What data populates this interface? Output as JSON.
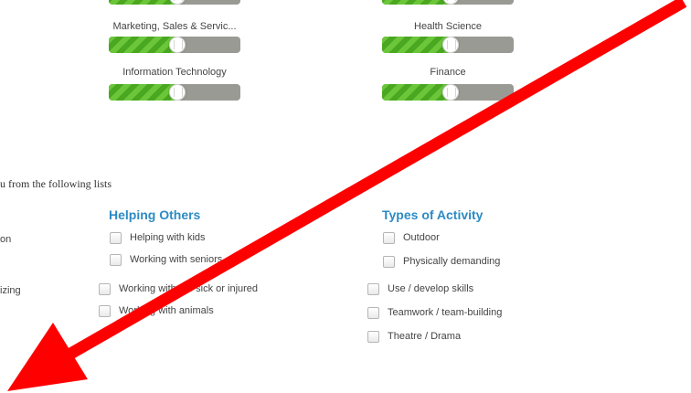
{
  "sliders": [
    {
      "label": "Marketing, Sales & Servic...",
      "level_percent": 52
    },
    {
      "label": "Health Science",
      "level_percent": 52
    },
    {
      "label": "Information Technology",
      "level_percent": 52
    },
    {
      "label": "Finance",
      "level_percent": 52
    }
  ],
  "intro_text": "u from the following lists",
  "left_column_fragments": [
    "on",
    "izing"
  ],
  "helping_others": {
    "heading": "Helping Others",
    "items": [
      "Helping with kids",
      "Working with seniors",
      "Working with the sick or injured",
      "Working with animals"
    ]
  },
  "types_of_activity": {
    "heading": "Types of Activity",
    "items": [
      "Outdoor",
      "Physically demanding",
      "Use / develop skills",
      "Teamwork / team-building",
      "Theatre / Drama"
    ]
  },
  "colors": {
    "heading": "#2d8bc4",
    "slider_fill": "#5cba2e",
    "slider_track": "#9a9a94",
    "arrow": "#ff0000"
  },
  "annotation": {
    "type": "arrow",
    "color": "red"
  }
}
